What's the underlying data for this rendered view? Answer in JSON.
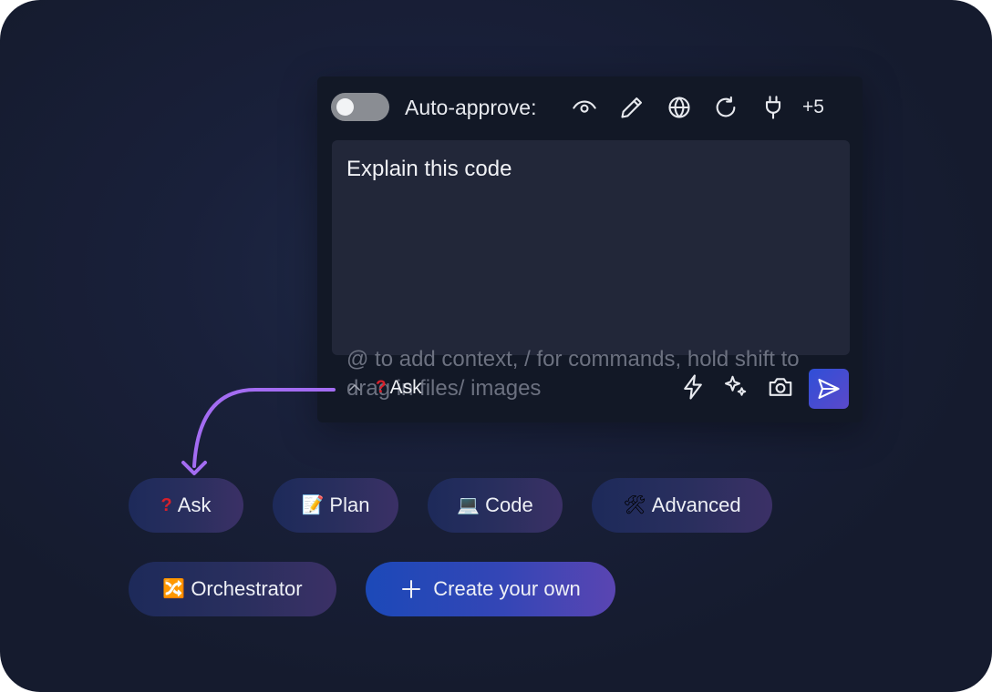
{
  "toolbar": {
    "auto_approve_enabled": false,
    "auto_approve_label": "Auto-approve:",
    "icons": [
      "eye-icon",
      "pencil-icon",
      "globe-icon",
      "refresh-icon",
      "plug-icon"
    ],
    "more_label": "+5"
  },
  "input": {
    "value": "Explain this code",
    "placeholder": "@ to add context, / for commands, hold shift to drag in files/ images"
  },
  "footer": {
    "mode_emoji": "?",
    "mode_label": "Ask",
    "icons": [
      "lightning-icon",
      "sparkles-icon",
      "camera-icon",
      "send-icon"
    ]
  },
  "modes": [
    {
      "emoji": "?",
      "label": "Ask"
    },
    {
      "emoji": "📝",
      "label": "Plan"
    },
    {
      "emoji": "💻",
      "label": "Code"
    },
    {
      "emoji": "🛠",
      "label": "Advanced"
    },
    {
      "emoji": "🔀",
      "label": "Orchestrator"
    }
  ],
  "create": {
    "label": "Create your own"
  },
  "colors": {
    "background": "#19203a",
    "panel": "#121826",
    "input": "#222739",
    "accent": "#a36cf2",
    "send": "#3a4cd6",
    "ask_icon": "#d8202a"
  }
}
